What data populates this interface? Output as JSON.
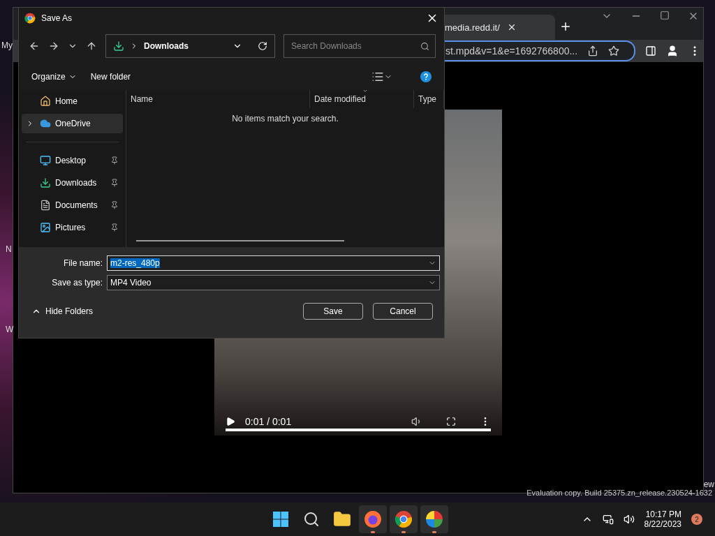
{
  "desktop": {
    "labels": [
      "My",
      "N",
      "W",
      "ew"
    ],
    "watermark": "Evaluation copy. Build 25375.zn_release.230524-1632"
  },
  "browser": {
    "tab": {
      "title": "media.redd.it/"
    },
    "address": "st.mpd&v=1&e=1692766800...",
    "video": {
      "time": "0:01 / 0:01",
      "level": 1
    }
  },
  "dialog": {
    "title": "Save As",
    "path": "Downloads",
    "search": {
      "placeholder": "Search Downloads"
    },
    "commands": [
      "Organize",
      "New folder"
    ],
    "sidebar": [
      {
        "label": "Home",
        "selected": false,
        "expandable": false,
        "pinned": false
      },
      {
        "label": "OneDrive",
        "selected": true,
        "expandable": true,
        "pinned": false
      },
      {
        "label": "Desktop",
        "selected": false,
        "expandable": false,
        "pinned": true
      },
      {
        "label": "Downloads",
        "selected": false,
        "expandable": false,
        "pinned": true
      },
      {
        "label": "Documents",
        "selected": false,
        "expandable": false,
        "pinned": true
      },
      {
        "label": "Pictures",
        "selected": false,
        "expandable": false,
        "pinned": true
      }
    ],
    "columns": [
      {
        "label": "Name",
        "sorted": false
      },
      {
        "label": "Date modified",
        "sorted": true
      },
      {
        "label": "Type",
        "sorted": false
      }
    ],
    "empty_message": "No items match your search.",
    "fields": [
      {
        "label": "File name:",
        "value": "m2-res_480p",
        "selected": true
      },
      {
        "label": "Save as type:",
        "value": "MP4 Video",
        "selected": false
      }
    ],
    "hide_folders": "Hide Folders",
    "buttons": [
      "Save",
      "Cancel"
    ]
  },
  "taskbar": {
    "apps": [
      {
        "running": false
      },
      {
        "running": false
      },
      {
        "running": false
      },
      {
        "running": true
      },
      {
        "running": true
      },
      {
        "running": true
      }
    ],
    "time": "10:17 PM",
    "date": "8/22/2023",
    "notifications": "2"
  }
}
